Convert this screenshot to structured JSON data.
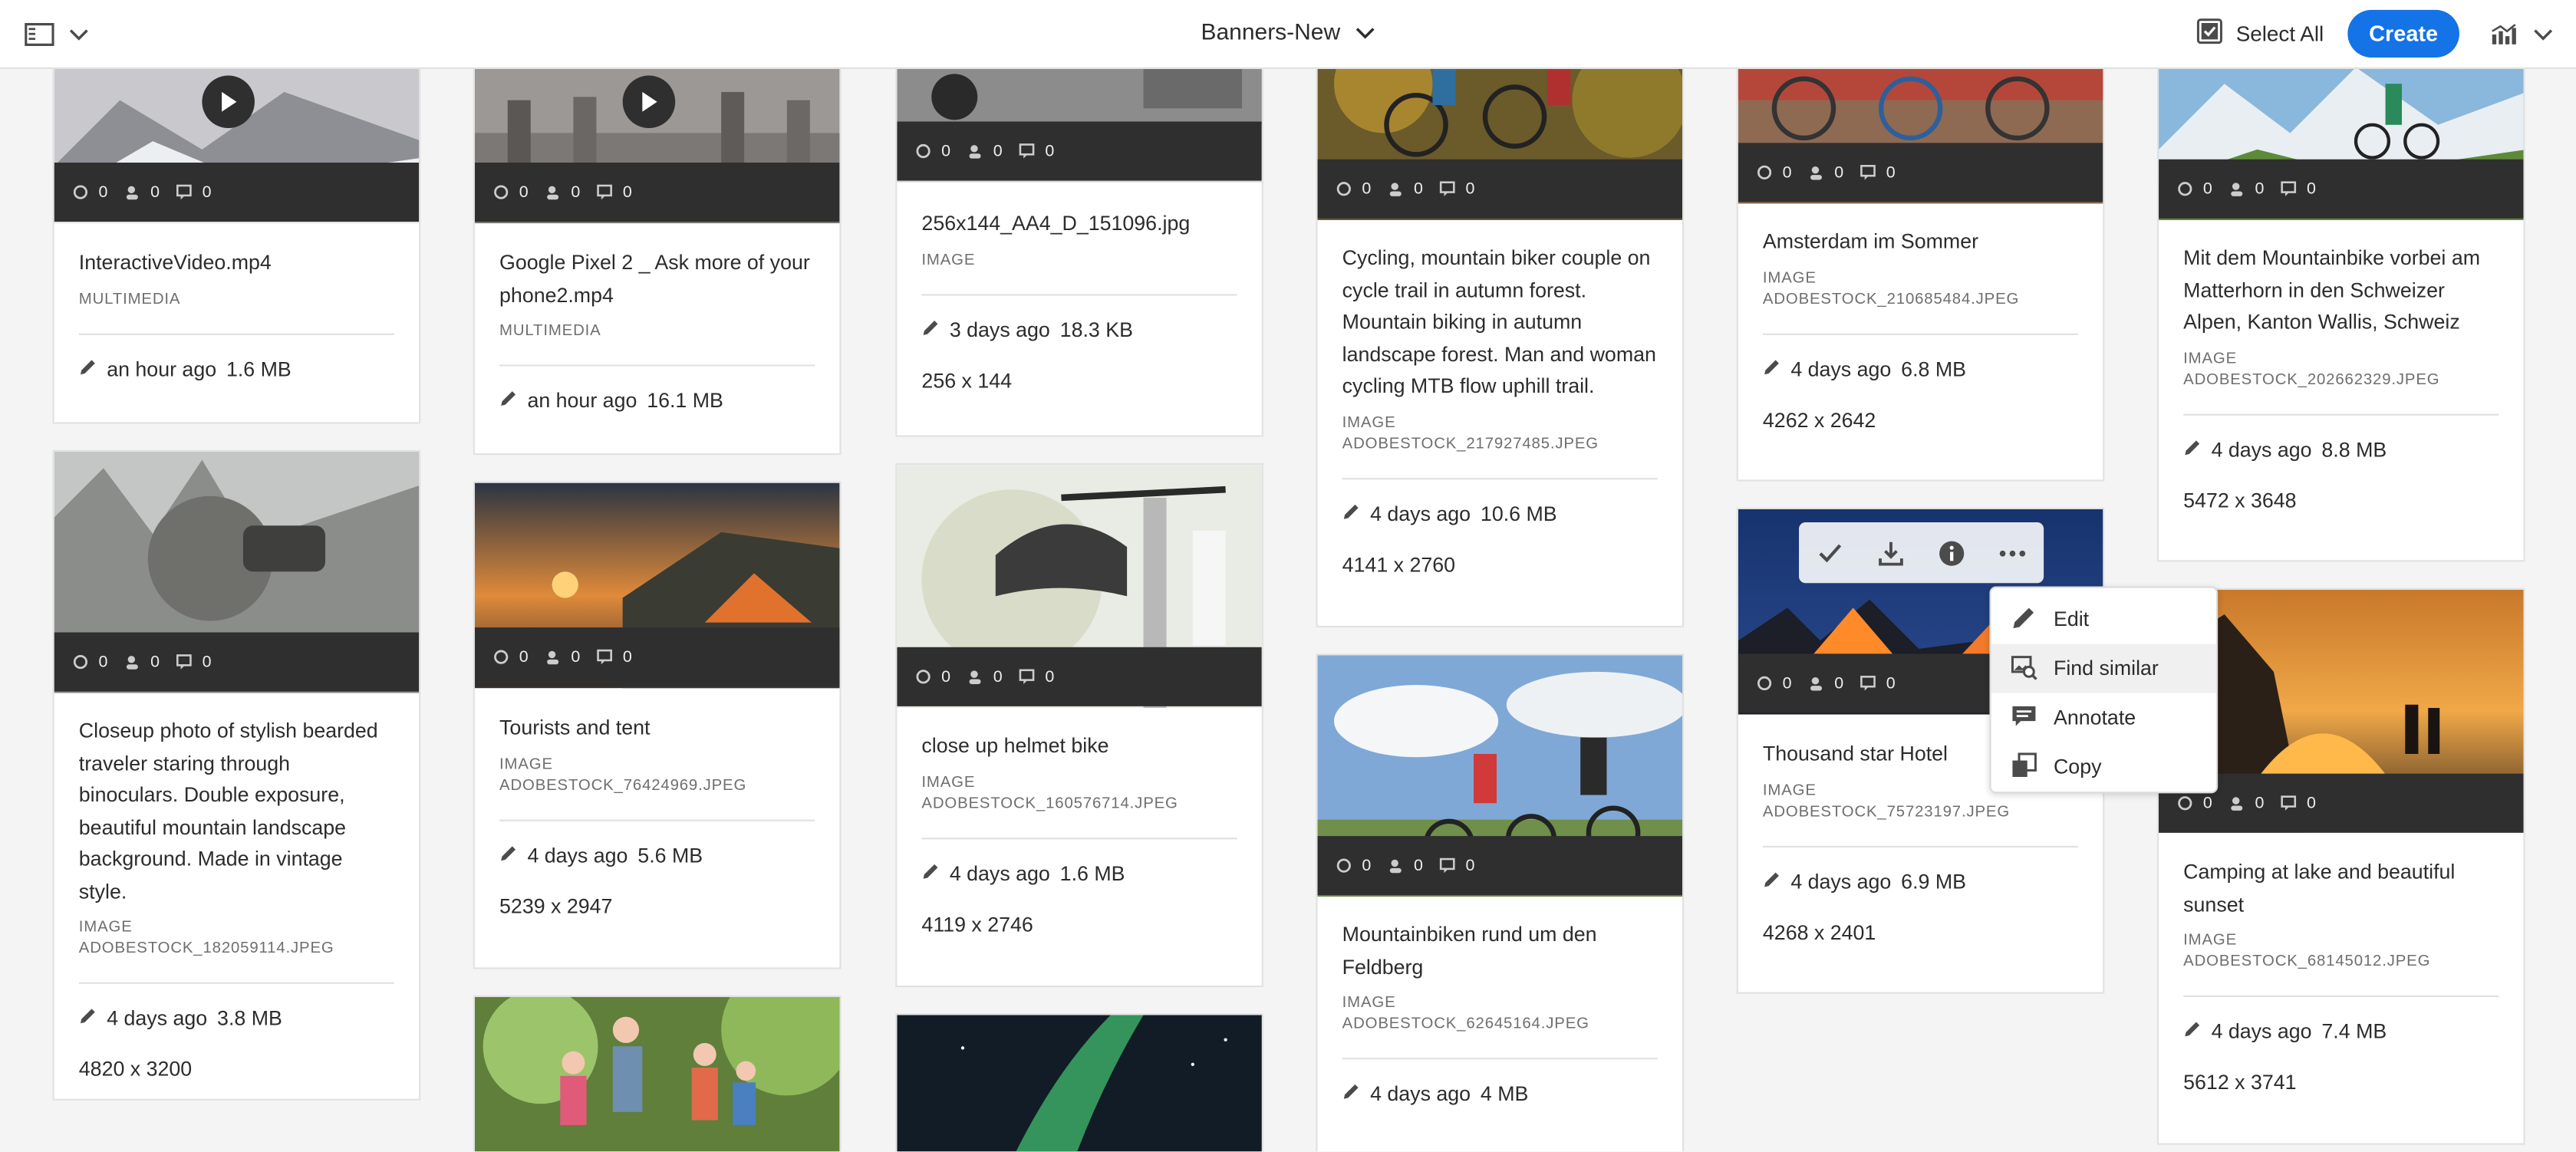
{
  "header": {
    "title": "Banners-New",
    "select_all": "Select All",
    "create": "Create"
  },
  "quick_actions": [
    "select-icon",
    "download-icon",
    "info-icon",
    "more-icon"
  ],
  "context_menu": [
    {
      "label": "Edit",
      "icon": "pencil-icon"
    },
    {
      "label": "Find similar",
      "icon": "find-similar-icon"
    },
    {
      "label": "Annotate",
      "icon": "annotate-icon"
    },
    {
      "label": "Copy",
      "icon": "copy-icon"
    }
  ],
  "cards": [
    {
      "name": "InteractiveVideo.mp4",
      "type": "MULTIMEDIA",
      "modified": "an hour ago",
      "size": "1.6 MB",
      "c1": "0",
      "c2": "0",
      "c3": "0"
    },
    {
      "name": "Google Pixel 2 _ Ask more of your phone2.mp4",
      "type": "MULTIMEDIA",
      "modified": "an hour ago",
      "size": "16.1 MB",
      "c1": "0",
      "c2": "0",
      "c3": "0"
    },
    {
      "name": "256x144_AA4_D_151096.jpg",
      "type": "IMAGE",
      "modified": "3 days ago",
      "size": "18.3 KB",
      "dims": "256 x 144",
      "c1": "0",
      "c2": "0",
      "c3": "0"
    },
    {
      "name": "Cycling, mountain biker couple on cycle trail in autumn forest. Mountain biking in autumn landscape forest. Man and woman cycling MTB flow uphill trail.",
      "type": "IMAGE",
      "file": "ADOBESTOCK_217927485.JPEG",
      "modified": "4 days ago",
      "size": "10.6 MB",
      "dims": "4141 x 2760",
      "c1": "0",
      "c2": "0",
      "c3": "0"
    },
    {
      "name": "Amsterdam im Sommer",
      "type": "IMAGE",
      "file": "ADOBESTOCK_210685484.JPEG",
      "modified": "4 days ago",
      "size": "6.8 MB",
      "dims": "4262 x 2642",
      "c1": "0",
      "c2": "0",
      "c3": "0"
    },
    {
      "name": "Mit dem Mountainbike vorbei am Matterhorn in den Schweizer Alpen, Kanton Wallis, Schweiz",
      "type": "IMAGE",
      "file": "ADOBESTOCK_202662329.JPEG",
      "modified": "4 days ago",
      "size": "8.8 MB",
      "dims": "5472 x 3648",
      "c1": "0",
      "c2": "0",
      "c3": "0"
    },
    {
      "name": "Closeup photo of stylish bearded traveler staring through binoculars. Double exposure, beautiful mountain landscape background. Made in vintage style.",
      "type": "IMAGE",
      "file": "ADOBESTOCK_182059114.JPEG",
      "modified": "4 days ago",
      "size": "3.8 MB",
      "dims": "4820 x 3200",
      "c1": "0",
      "c2": "0",
      "c3": "0"
    },
    {
      "name": "Tourists and tent",
      "type": "IMAGE",
      "file": "ADOBESTOCK_76424969.JPEG",
      "modified": "4 days ago",
      "size": "5.6 MB",
      "dims": "5239 x 2947",
      "c1": "0",
      "c2": "0",
      "c3": "0"
    },
    {
      "name": "close up helmet bike",
      "type": "IMAGE",
      "file": "ADOBESTOCK_160576714.JPEG",
      "modified": "4 days ago",
      "size": "1.6 MB",
      "dims": "4119 x 2746",
      "c1": "0",
      "c2": "0",
      "c3": "0"
    },
    {
      "name": "Mountainbiken rund um den Feldberg",
      "type": "IMAGE",
      "file": "ADOBESTOCK_62645164.JPEG",
      "modified": "4 days ago",
      "size": "4 MB",
      "c1": "0",
      "c2": "0",
      "c3": "0"
    },
    {
      "name": "Thousand star Hotel",
      "type": "IMAGE",
      "file": "ADOBESTOCK_75723197.JPEG",
      "modified": "4 days ago",
      "size": "6.9 MB",
      "dims": "4268 x 2401",
      "c1": "0",
      "c2": "0",
      "c3": "0"
    },
    {
      "name": "Camping at lake and beautiful sunset",
      "type": "IMAGE",
      "file": "ADOBESTOCK_68145012.JPEG",
      "modified": "4 days ago",
      "size": "7.4 MB",
      "dims": "5612 x 3741",
      "c1": "0",
      "c2": "0",
      "c3": "0"
    }
  ]
}
